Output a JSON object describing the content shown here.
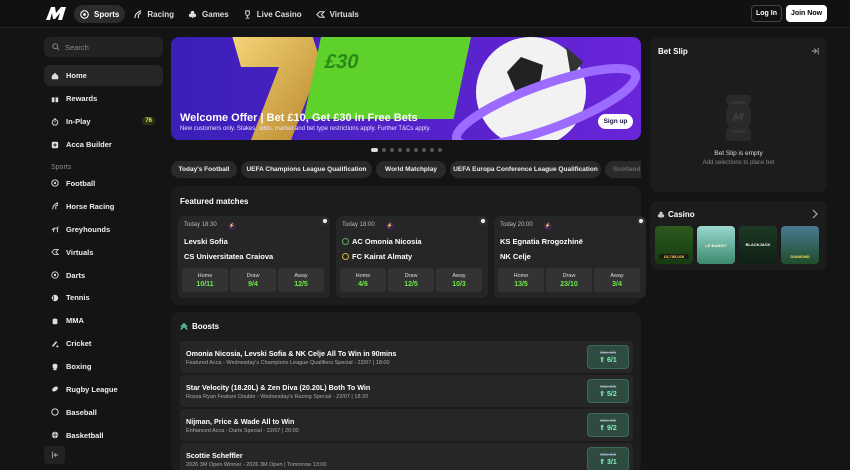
{
  "topbar": {
    "nav": [
      {
        "label": "Sports",
        "icon": "soccer-ball-icon",
        "active": true
      },
      {
        "label": "Racing",
        "icon": "horse-icon"
      },
      {
        "label": "Games",
        "icon": "club-icon"
      },
      {
        "label": "Live Casino",
        "icon": "trophy-icon"
      },
      {
        "label": "Virtuals",
        "icon": "virtual-icon"
      }
    ],
    "login_label": "Log In",
    "join_label": "Join Now"
  },
  "sidebar": {
    "search_placeholder": "Search",
    "items": [
      {
        "label": "Home",
        "icon": "home-icon",
        "active": true
      },
      {
        "label": "Rewards",
        "icon": "gift-icon"
      },
      {
        "label": "In-Play",
        "icon": "stopwatch-icon",
        "badge": "76"
      },
      {
        "label": "Acca Builder",
        "icon": "builder-icon"
      }
    ],
    "sports_heading": "Sports",
    "sports": [
      "Football",
      "Horse Racing",
      "Greyhounds",
      "Virtuals",
      "Darts",
      "Tennis",
      "MMA",
      "Cricket",
      "Boxing",
      "Rugby League",
      "Baseball",
      "Basketball"
    ]
  },
  "banner": {
    "title": "Welcome Offer | Bet £10, Get £30 in Free Bets",
    "subtitle": "New customers only. Stakes, odds, market and bet type restrictions apply. Further T&Cs apply.",
    "cta": "Sign up",
    "graphic_text": "£30"
  },
  "filters": [
    "Today's Football",
    "UEFA Champions League Qualification",
    "World Matchplay",
    "UEFA Europa Conference League Qualification",
    "Scotland"
  ],
  "featured": {
    "title": "Featured matches",
    "matches": [
      {
        "time": "Today 18:30",
        "home": "Levski Sofia",
        "away": "CS Universitatea Craiova",
        "odds": [
          {
            "label": "Home",
            "value": "10/11"
          },
          {
            "label": "Draw",
            "value": "9/4"
          },
          {
            "label": "Away",
            "value": "12/5"
          }
        ]
      },
      {
        "time": "Today 18:00",
        "home": "AC Omonia Nicosia",
        "away": "FC Kairat Almaty",
        "odds": [
          {
            "label": "Home",
            "value": "4/6"
          },
          {
            "label": "Draw",
            "value": "12/5"
          },
          {
            "label": "Away",
            "value": "10/3"
          }
        ]
      },
      {
        "time": "Today 20:00",
        "home": "KS Egnatia Rrogozhinë",
        "away": "NK Celje",
        "odds": [
          {
            "label": "Home",
            "value": "13/5"
          },
          {
            "label": "Draw",
            "value": "23/10"
          },
          {
            "label": "Away",
            "value": "3/4"
          }
        ]
      }
    ]
  },
  "boosts": {
    "title": "Boosts",
    "items": [
      {
        "name": "Omonia Nicosia, Levski Sofia & NK Celje All To Win in 90mins",
        "desc": "Featured Acca - Wednesday's Champions League Qualifiers Special - 22/07 | 18:00",
        "was": "Was 5/1",
        "now": "6/1"
      },
      {
        "name": "Star Velocity (18.20L) & Zen Diva (20.20L) Both To Win",
        "desc": "Rossa Ryan Feature Double - Wednesday's Racing Special - 22/07 | 18:20",
        "was": "Was 2/1",
        "now": "5/2"
      },
      {
        "name": "Nijman, Price & Wade All to Win",
        "desc": "Enhanced Acca - Darts Special - 22/07 | 20:00",
        "was": "Was 4/1",
        "now": "9/2"
      },
      {
        "name": "Scottie Scheffler",
        "desc": "2026 3M Open Winner - 2026 3M Open | Tomorrow 13:00",
        "was": "Was 5/2",
        "now": "3/1"
      }
    ]
  },
  "betslip": {
    "title": "Bet Slip",
    "empty_title": "Bet Slip is empty",
    "empty_sub": "Add selections to place bet"
  },
  "casino": {
    "title": "Casino",
    "tiles": [
      "£8,785,028",
      "LE BANDIT",
      "BLACKJACK",
      "DIAMOND"
    ]
  },
  "colors": {
    "odds_green": "#6ee84a",
    "boost_teal": "#7ef2c9",
    "banner_purple": "#5a22d0",
    "background": "#141414"
  }
}
